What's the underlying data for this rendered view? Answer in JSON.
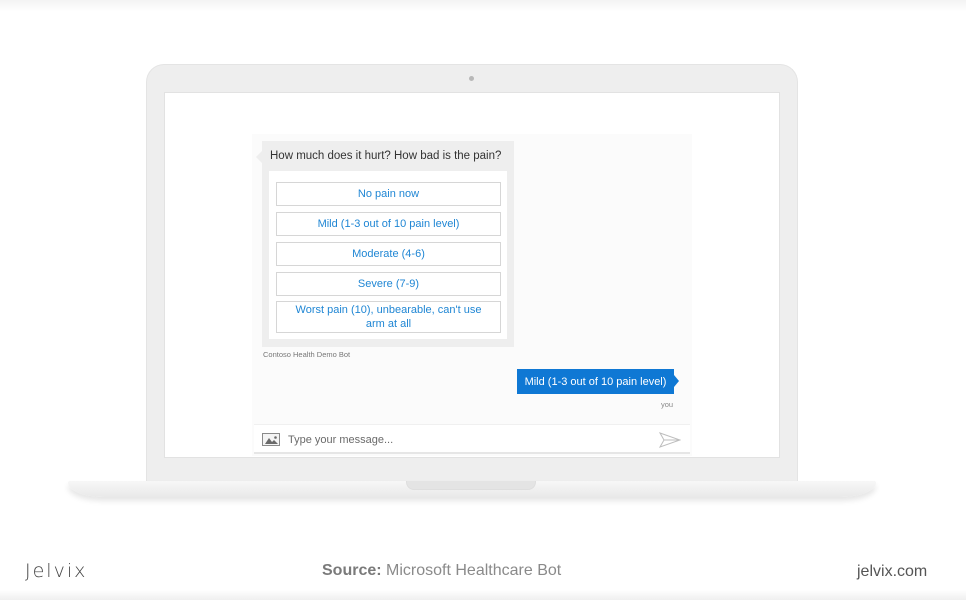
{
  "chat": {
    "bot_question": "How much does it hurt? How bad is the pain?",
    "options": [
      "No pain now",
      "Mild (1-3 out of 10 pain level)",
      "Moderate (4-6)",
      "Severe (7-9)",
      "Worst pain (10), unbearable, can't use arm at all"
    ],
    "bot_name": "Contoso Health Demo Bot",
    "user_message": "Mild (1-3 out of 10 pain level)",
    "user_label": "you",
    "input_placeholder": "Type your message...",
    "input_value": "",
    "accent_color": "#0f78d4",
    "option_text_color": "#1f86d4"
  },
  "footer": {
    "brand": "Jelvix",
    "source_label": "Source:",
    "source_value": "Microsoft Healthcare Bot",
    "site": "jelvix.com"
  }
}
